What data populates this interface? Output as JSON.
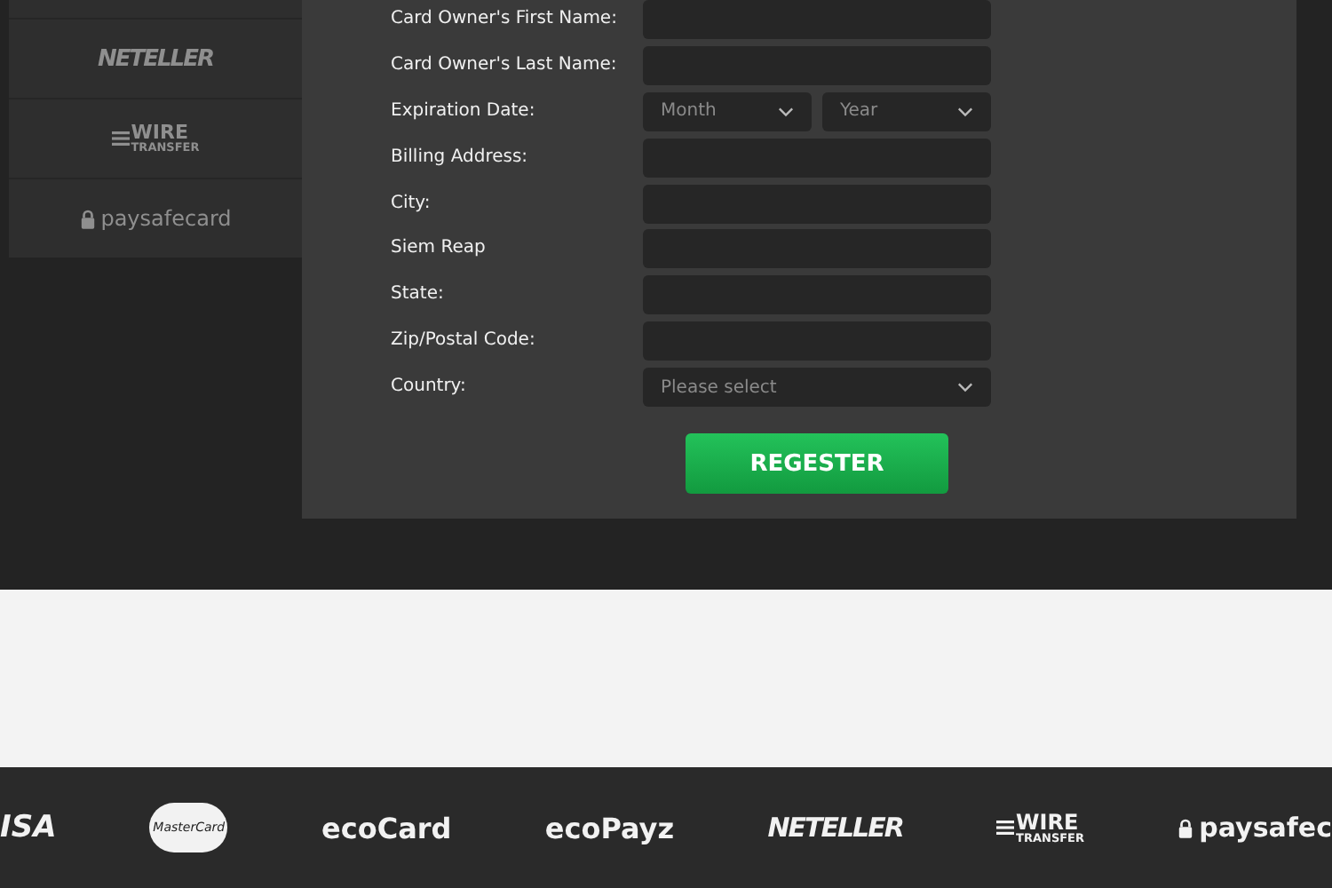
{
  "sidebar": {
    "items": [
      {
        "kind": "neteller",
        "text": "NETELLER"
      },
      {
        "kind": "wire",
        "lines": [
          "WIRE",
          "TRANSFER"
        ]
      },
      {
        "kind": "paysafe",
        "text": "paysafecard"
      }
    ]
  },
  "form": {
    "fields": [
      {
        "kind": "text",
        "label": "Card Owner's First Name:"
      },
      {
        "kind": "text",
        "label": "Card Owner's Last Name:"
      },
      {
        "kind": "date",
        "label": "Expiration Date:",
        "selects": [
          "Month",
          "Year"
        ]
      },
      {
        "kind": "text",
        "label": "Billing Address:"
      },
      {
        "kind": "text",
        "label": "City:"
      },
      {
        "kind": "text",
        "label": "Siem Reap"
      },
      {
        "kind": "text",
        "label": "State:"
      },
      {
        "kind": "text",
        "label": "Zip/Postal Code:"
      },
      {
        "kind": "select",
        "label": "Country:",
        "placeholder": "Please select"
      }
    ],
    "button": "REGESTER"
  },
  "footer": {
    "logos": [
      {
        "kind": "visa",
        "text": "ISA"
      },
      {
        "kind": "mastercard",
        "text": "MasterCard"
      },
      {
        "kind": "ecocard",
        "text": "ecoCard"
      },
      {
        "kind": "ecopayz",
        "text": "ecoPayz"
      },
      {
        "kind": "neteller",
        "text": "NETELLER"
      },
      {
        "kind": "wire",
        "lines": [
          "WIRE",
          "TRANSFER"
        ]
      },
      {
        "kind": "paysafe",
        "text": "paysafec"
      }
    ]
  }
}
